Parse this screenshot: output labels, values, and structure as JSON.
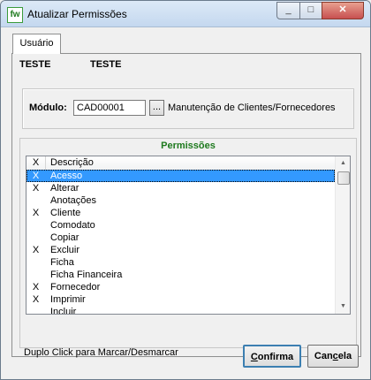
{
  "window": {
    "title": "Atualizar Permissões",
    "icon": "fw-app-icon",
    "controls": {
      "min": "_",
      "max": "□",
      "close": "✕"
    }
  },
  "tabs": [
    {
      "label": "Usuário",
      "active": true
    }
  ],
  "user": {
    "code": "TESTE",
    "name": "TESTE"
  },
  "module": {
    "label": "Módulo:",
    "value": "CAD00001",
    "browse_label": "...",
    "description": "Manutenção de Clientes/Fornecedores"
  },
  "permissions": {
    "title": "Permissões",
    "columns": {
      "x": "X",
      "desc": "Descrição"
    },
    "rows": [
      {
        "x": "X",
        "desc": "Acesso",
        "selected": true
      },
      {
        "x": "X",
        "desc": "Alterar"
      },
      {
        "x": "",
        "desc": "Anotações"
      },
      {
        "x": "X",
        "desc": "Cliente"
      },
      {
        "x": "",
        "desc": "Comodato"
      },
      {
        "x": "",
        "desc": "Copiar"
      },
      {
        "x": "X",
        "desc": "Excluir"
      },
      {
        "x": "",
        "desc": "Ficha"
      },
      {
        "x": "",
        "desc": "Ficha Financeira"
      },
      {
        "x": "X",
        "desc": "Fornecedor"
      },
      {
        "x": "X",
        "desc": "Imprimir"
      },
      {
        "x": "",
        "desc": "Incluir"
      }
    ],
    "scroll": {
      "up": "▲",
      "down": "▼"
    }
  },
  "footer": {
    "hint": "Duplo Click para Marcar/Desmarcar",
    "confirm": {
      "accel": "C",
      "rest": "onfirma"
    },
    "cancel": {
      "pre": "Can",
      "accel": "c",
      "rest": "ela"
    }
  },
  "colors": {
    "selection": "#3399ff",
    "permissions_title": "#1e7a1e"
  }
}
